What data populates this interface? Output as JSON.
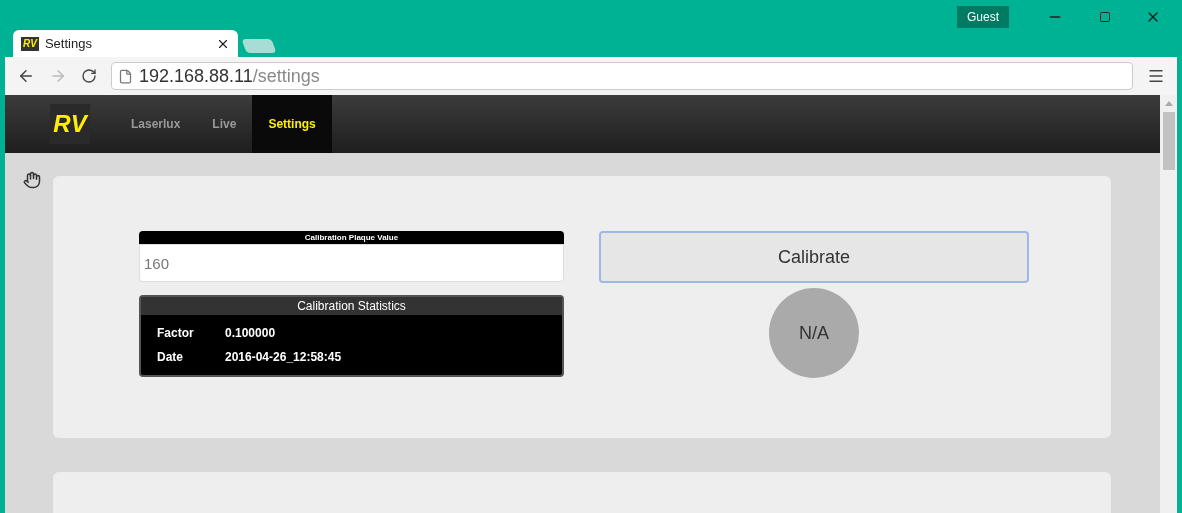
{
  "browser": {
    "tabs": [
      {
        "favicon_text": "RV",
        "title": "Settings",
        "selected": true
      }
    ],
    "profile": "Guest",
    "url_host": "192.168.88.11",
    "url_path": "/settings"
  },
  "navbar": {
    "logo_text": "RV",
    "items": [
      {
        "label": "Laserlux",
        "selected": false
      },
      {
        "label": "Live",
        "selected": false
      },
      {
        "label": "Settings",
        "selected": true
      }
    ]
  },
  "calibration": {
    "plaque_label": "Calibration Plaque Value",
    "plaque_value": "160",
    "stats_title": "Calibration Statistics",
    "stats": [
      {
        "label": "Factor",
        "value": "0.100000"
      },
      {
        "label": "Date",
        "value": "2016-04-26_12:58:45"
      }
    ],
    "button": "Calibrate",
    "status": "N/A"
  }
}
